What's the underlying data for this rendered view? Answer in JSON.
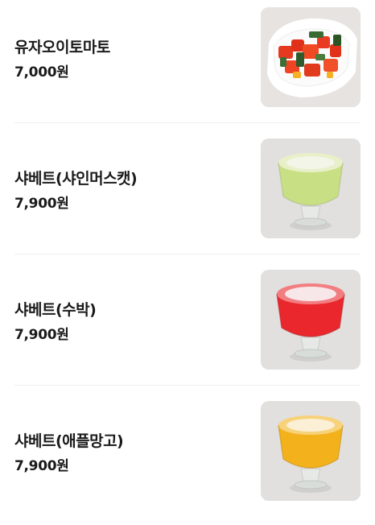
{
  "menu": {
    "items": [
      {
        "name": "유자오이토마토",
        "price": "7,000원",
        "image_icon": "salad-image"
      },
      {
        "name": "샤베트(샤인머스캣)",
        "price": "7,900원",
        "image_icon": "sherbet-shine-muscat-image",
        "color": "#c9df84"
      },
      {
        "name": "샤베트(수박)",
        "price": "7,900원",
        "image_icon": "sherbet-watermelon-image",
        "color": "#e9272d"
      },
      {
        "name": "샤베트(애플망고)",
        "price": "7,900원",
        "image_icon": "sherbet-apple-mango-image",
        "color": "#f3b21c"
      }
    ]
  }
}
